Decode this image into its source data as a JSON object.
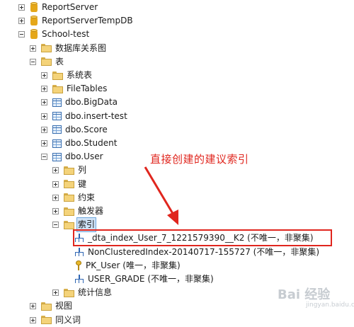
{
  "tree": [
    {
      "label": "ReportServer",
      "icon": "database-icon",
      "expander": "collapsed",
      "depth": 0
    },
    {
      "label": "ReportServerTempDB",
      "icon": "database-icon",
      "expander": "collapsed",
      "depth": 0
    },
    {
      "label": "School-test",
      "icon": "database-icon",
      "expander": "expanded",
      "depth": 0
    },
    {
      "label": "数据库关系图",
      "icon": "folder-icon",
      "expander": "collapsed",
      "depth": 1
    },
    {
      "label": "表",
      "icon": "folder-icon",
      "expander": "expanded",
      "depth": 1
    },
    {
      "label": "系统表",
      "icon": "folder-icon",
      "expander": "collapsed",
      "depth": 2
    },
    {
      "label": "FileTables",
      "icon": "folder-icon",
      "expander": "collapsed",
      "depth": 2
    },
    {
      "label": "dbo.BigData",
      "icon": "table-icon",
      "expander": "collapsed",
      "depth": 2
    },
    {
      "label": "dbo.insert-test",
      "icon": "table-icon",
      "expander": "collapsed",
      "depth": 2
    },
    {
      "label": "dbo.Score",
      "icon": "table-icon",
      "expander": "collapsed",
      "depth": 2
    },
    {
      "label": "dbo.Student",
      "icon": "table-icon",
      "expander": "collapsed",
      "depth": 2
    },
    {
      "label": "dbo.User",
      "icon": "table-icon",
      "expander": "expanded",
      "depth": 2
    },
    {
      "label": "列",
      "icon": "folder-icon",
      "expander": "collapsed",
      "depth": 3
    },
    {
      "label": "键",
      "icon": "folder-icon",
      "expander": "collapsed",
      "depth": 3
    },
    {
      "label": "约束",
      "icon": "folder-icon",
      "expander": "collapsed",
      "depth": 3
    },
    {
      "label": "触发器",
      "icon": "folder-icon",
      "expander": "collapsed",
      "depth": 3
    },
    {
      "label": "索引",
      "icon": "folder-icon",
      "expander": "expanded",
      "depth": 3,
      "selected": true
    },
    {
      "label": "_dta_index_User_7_1221579390__K2 (不唯一，非聚集)",
      "icon": "index-icon",
      "expander": "none",
      "depth": 4
    },
    {
      "label": "NonClusteredIndex-20140717-155727 (不唯一，非聚集)",
      "icon": "index-icon",
      "expander": "none",
      "depth": 4
    },
    {
      "label": "PK_User (唯一，非聚集)",
      "icon": "key-icon",
      "expander": "none",
      "depth": 4
    },
    {
      "label": "USER_GRADE (不唯一，非聚集)",
      "icon": "index-icon",
      "expander": "none",
      "depth": 4
    },
    {
      "label": "统计信息",
      "icon": "folder-icon",
      "expander": "collapsed",
      "depth": 3
    },
    {
      "label": "视图",
      "icon": "folder-icon",
      "expander": "collapsed",
      "depth": 1
    },
    {
      "label": "同义词",
      "icon": "folder-icon",
      "expander": "collapsed",
      "depth": 1
    }
  ],
  "annotation": {
    "text": "直接创建的建议索引",
    "color": "#e0261e"
  },
  "watermark": {
    "logo": "Bai 经验",
    "sub": "jingyan.baidu.com"
  },
  "colors": {
    "selection": "#cfe3f7",
    "annotation_red": "#e0261e"
  }
}
